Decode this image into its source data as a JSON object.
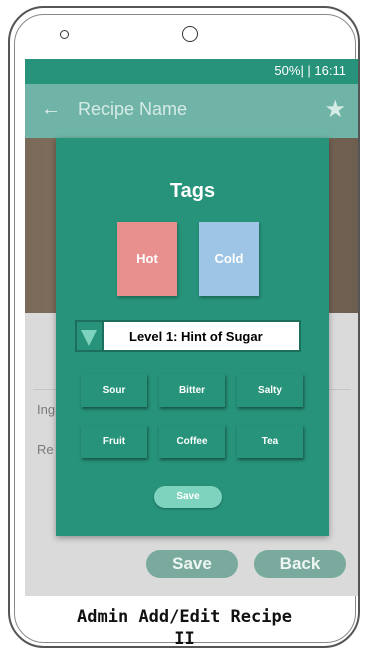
{
  "status_bar": {
    "text": "50%| | 16:11"
  },
  "app_bar": {
    "title": "Recipe Name",
    "back_icon": "arrow-left-icon",
    "favorite_icon": "star-icon"
  },
  "background_fields": {
    "ingredients_label": "Ing",
    "recipe_label": "Re"
  },
  "bottom_buttons": {
    "save": "Save",
    "back": "Back"
  },
  "dialog": {
    "title": "Tags",
    "tags": [
      {
        "label": "Hot",
        "color": "#e8908e"
      },
      {
        "label": "Cold",
        "color": "#9ec4e6"
      }
    ],
    "dropdown": {
      "selected": "Level 1: Hint of Sugar"
    },
    "flavors": [
      "Sour",
      "Bitter",
      "Salty",
      "Fruit",
      "Coffee",
      "Tea"
    ],
    "save_label": "Save"
  },
  "colors": {
    "primary": "#27937a",
    "accent": "#7dd3bd",
    "app_bar": "#6fb4a6"
  },
  "caption": {
    "line1": "Admin Add/Edit Recipe",
    "line2": "II"
  }
}
